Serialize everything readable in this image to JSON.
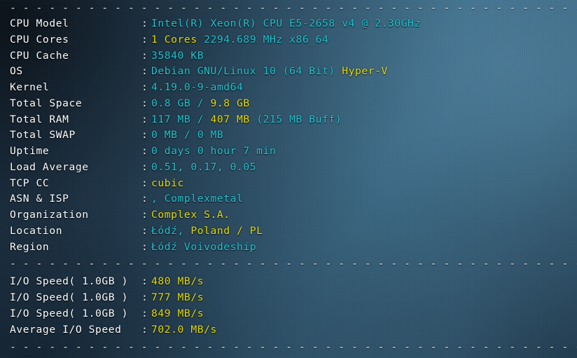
{
  "terminal": {
    "separator": "- - - - - - - - - - - - - - - - - - - - - - - - - - - - - - - - - - - - - - - - - - - - - - - - - -",
    "colon": ":",
    "system_rows": [
      {
        "label": "CPU Model",
        "parts": [
          {
            "text": "Intel(R) Xeon(R) CPU E5-2658 v4 @ 2.30GHz",
            "color": "cyan"
          }
        ]
      },
      {
        "label": "CPU Cores",
        "parts": [
          {
            "text": "1 Cores",
            "color": "yellow"
          },
          {
            "text": " 2294.689 MHz x86_64",
            "color": "cyan"
          }
        ]
      },
      {
        "label": "CPU Cache",
        "parts": [
          {
            "text": "35840 KB",
            "color": "cyan"
          }
        ]
      },
      {
        "label": "OS",
        "parts": [
          {
            "text": "Debian GNU/Linux 10 (64 Bit) ",
            "color": "cyan"
          },
          {
            "text": "Hyper-V",
            "color": "yellow"
          }
        ]
      },
      {
        "label": "Kernel",
        "parts": [
          {
            "text": "4.19.0-9-amd64",
            "color": "cyan"
          }
        ]
      },
      {
        "label": "Total Space",
        "parts": [
          {
            "text": "0.8 GB / ",
            "color": "cyan"
          },
          {
            "text": "9.8 GB",
            "color": "yellow"
          }
        ]
      },
      {
        "label": "Total RAM",
        "parts": [
          {
            "text": "117 MB / ",
            "color": "cyan"
          },
          {
            "text": "407 MB",
            "color": "yellow"
          },
          {
            "text": " (215 MB Buff)",
            "color": "cyan"
          }
        ]
      },
      {
        "label": "Total SWAP",
        "parts": [
          {
            "text": "0 MB / 0 MB",
            "color": "cyan"
          }
        ]
      },
      {
        "label": "Uptime",
        "parts": [
          {
            "text": "0 days 0 hour 7 min",
            "color": "cyan"
          }
        ]
      },
      {
        "label": "Load Average",
        "parts": [
          {
            "text": "0.51, 0.17, 0.05",
            "color": "cyan"
          }
        ]
      },
      {
        "label": "TCP CC",
        "parts": [
          {
            "text": "cubic",
            "color": "yellow"
          }
        ]
      },
      {
        "label": "ASN & ISP",
        "parts": [
          {
            "text": ", Complexmetal",
            "color": "cyan"
          }
        ]
      },
      {
        "label": "Organization",
        "parts": [
          {
            "text": "Complex S.A.",
            "color": "yellow"
          }
        ]
      },
      {
        "label": "Location",
        "parts": [
          {
            "text": "Łódź, ",
            "color": "cyan"
          },
          {
            "text": "Poland / PL",
            "color": "yellow"
          }
        ]
      },
      {
        "label": "Region",
        "parts": [
          {
            "text": "Łódź Voivodeship",
            "color": "cyan"
          }
        ]
      }
    ],
    "io_rows": [
      {
        "label": "I/O Speed( 1.0GB )",
        "parts": [
          {
            "text": "480 MB/s",
            "color": "yellow"
          }
        ]
      },
      {
        "label": "I/O Speed( 1.0GB )",
        "parts": [
          {
            "text": "777 MB/s",
            "color": "yellow"
          }
        ]
      },
      {
        "label": "I/O Speed( 1.0GB )",
        "parts": [
          {
            "text": "849 MB/s",
            "color": "yellow"
          }
        ]
      },
      {
        "label": "Average I/O Speed",
        "parts": [
          {
            "text": "702.0 MB/s",
            "color": "yellow"
          }
        ]
      }
    ],
    "colors": {
      "label": "#fdfeff",
      "cyan": "#22c4d2",
      "yellow": "#e3dc0c",
      "background_dark": "#18283a",
      "background_light": "#3b6a86"
    }
  }
}
